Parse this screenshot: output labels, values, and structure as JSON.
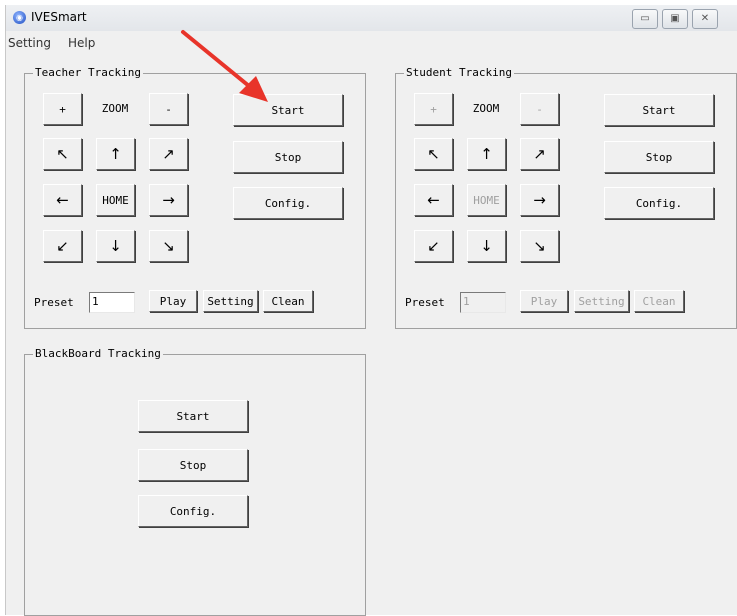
{
  "window": {
    "title": "IVESmart"
  },
  "menu": [
    "Setting",
    "Help"
  ],
  "teacher": {
    "title": "Teacher Tracking",
    "zoom_in": "+",
    "zoom_label": "ZOOM",
    "zoom_out": "-",
    "home": "HOME",
    "arrows": {
      "nw": "↖",
      "n": "↑",
      "ne": "↗",
      "w": "←",
      "e": "→",
      "sw": "↙",
      "s": "↓",
      "se": "↘"
    },
    "start": "Start",
    "stop": "Stop",
    "config": "Config.",
    "preset_label": "Preset",
    "preset_value": "1",
    "play": "Play",
    "setting": "Setting",
    "clean": "Clean"
  },
  "student": {
    "title": "Student Tracking",
    "zoom_in": "+",
    "zoom_label": "ZOOM",
    "zoom_out": "-",
    "home": "HOME",
    "arrows": {
      "nw": "↖",
      "n": "↑",
      "ne": "↗",
      "w": "←",
      "e": "→",
      "sw": "↙",
      "s": "↓",
      "se": "↘"
    },
    "start": "Start",
    "stop": "Stop",
    "config": "Config.",
    "preset_label": "Preset",
    "preset_value": "1",
    "play": "Play",
    "setting": "Setting",
    "clean": "Clean"
  },
  "blackboard": {
    "title": "BlackBoard Tracking",
    "start": "Start",
    "stop": "Stop",
    "config": "Config."
  },
  "colors": {
    "annotation_arrow": "#e8342a"
  }
}
